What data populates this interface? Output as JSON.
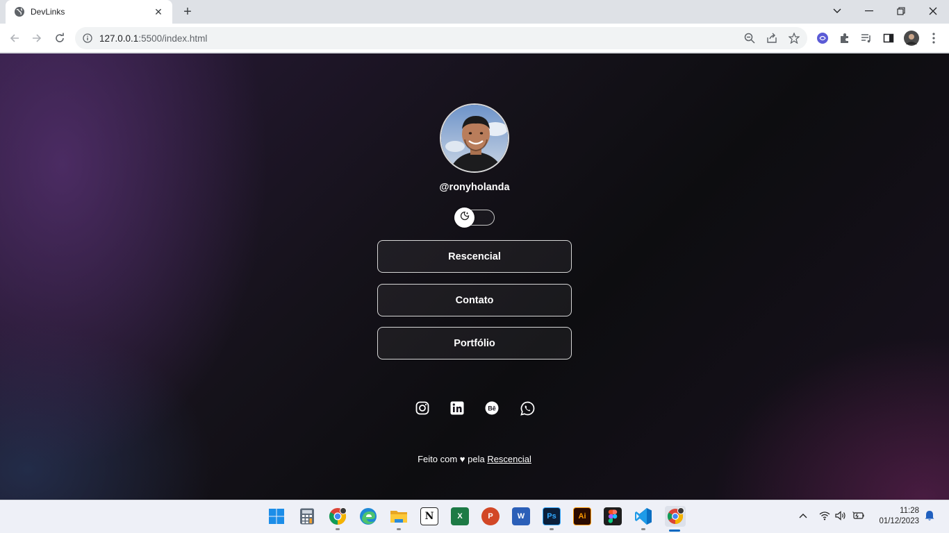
{
  "browser": {
    "tab_title": "DevLinks",
    "url_host": "127.0.0.1",
    "url_path": ":5500/index.html"
  },
  "profile": {
    "username": "@ronyholanda",
    "theme_toggle_state": "dark"
  },
  "links": [
    {
      "label": "Rescencial"
    },
    {
      "label": "Contato"
    },
    {
      "label": "Portfólio"
    }
  ],
  "social": [
    "instagram",
    "linkedin",
    "behance",
    "whatsapp"
  ],
  "footer": {
    "prefix": "Feito com ♥ pela ",
    "link_text": "Rescencial"
  },
  "taskbar": {
    "apps": [
      "windows-start",
      "calculator",
      "chrome",
      "edge",
      "file-explorer",
      "notion",
      "excel",
      "powerpoint",
      "word",
      "photoshop",
      "illustrator",
      "figma",
      "vscode",
      "chrome"
    ],
    "photoshop_label": "Ps",
    "illustrator_label": "Ai",
    "notion_label": "N",
    "word_label": "W",
    "excel_label": "X",
    "powerpoint_label": "P",
    "time": "11:28",
    "date": "01/12/2023"
  },
  "colors": {
    "page_bg_dark": "#0d0d10",
    "accent_purple": "#5c3478",
    "button_border": "#d7d7d7"
  }
}
